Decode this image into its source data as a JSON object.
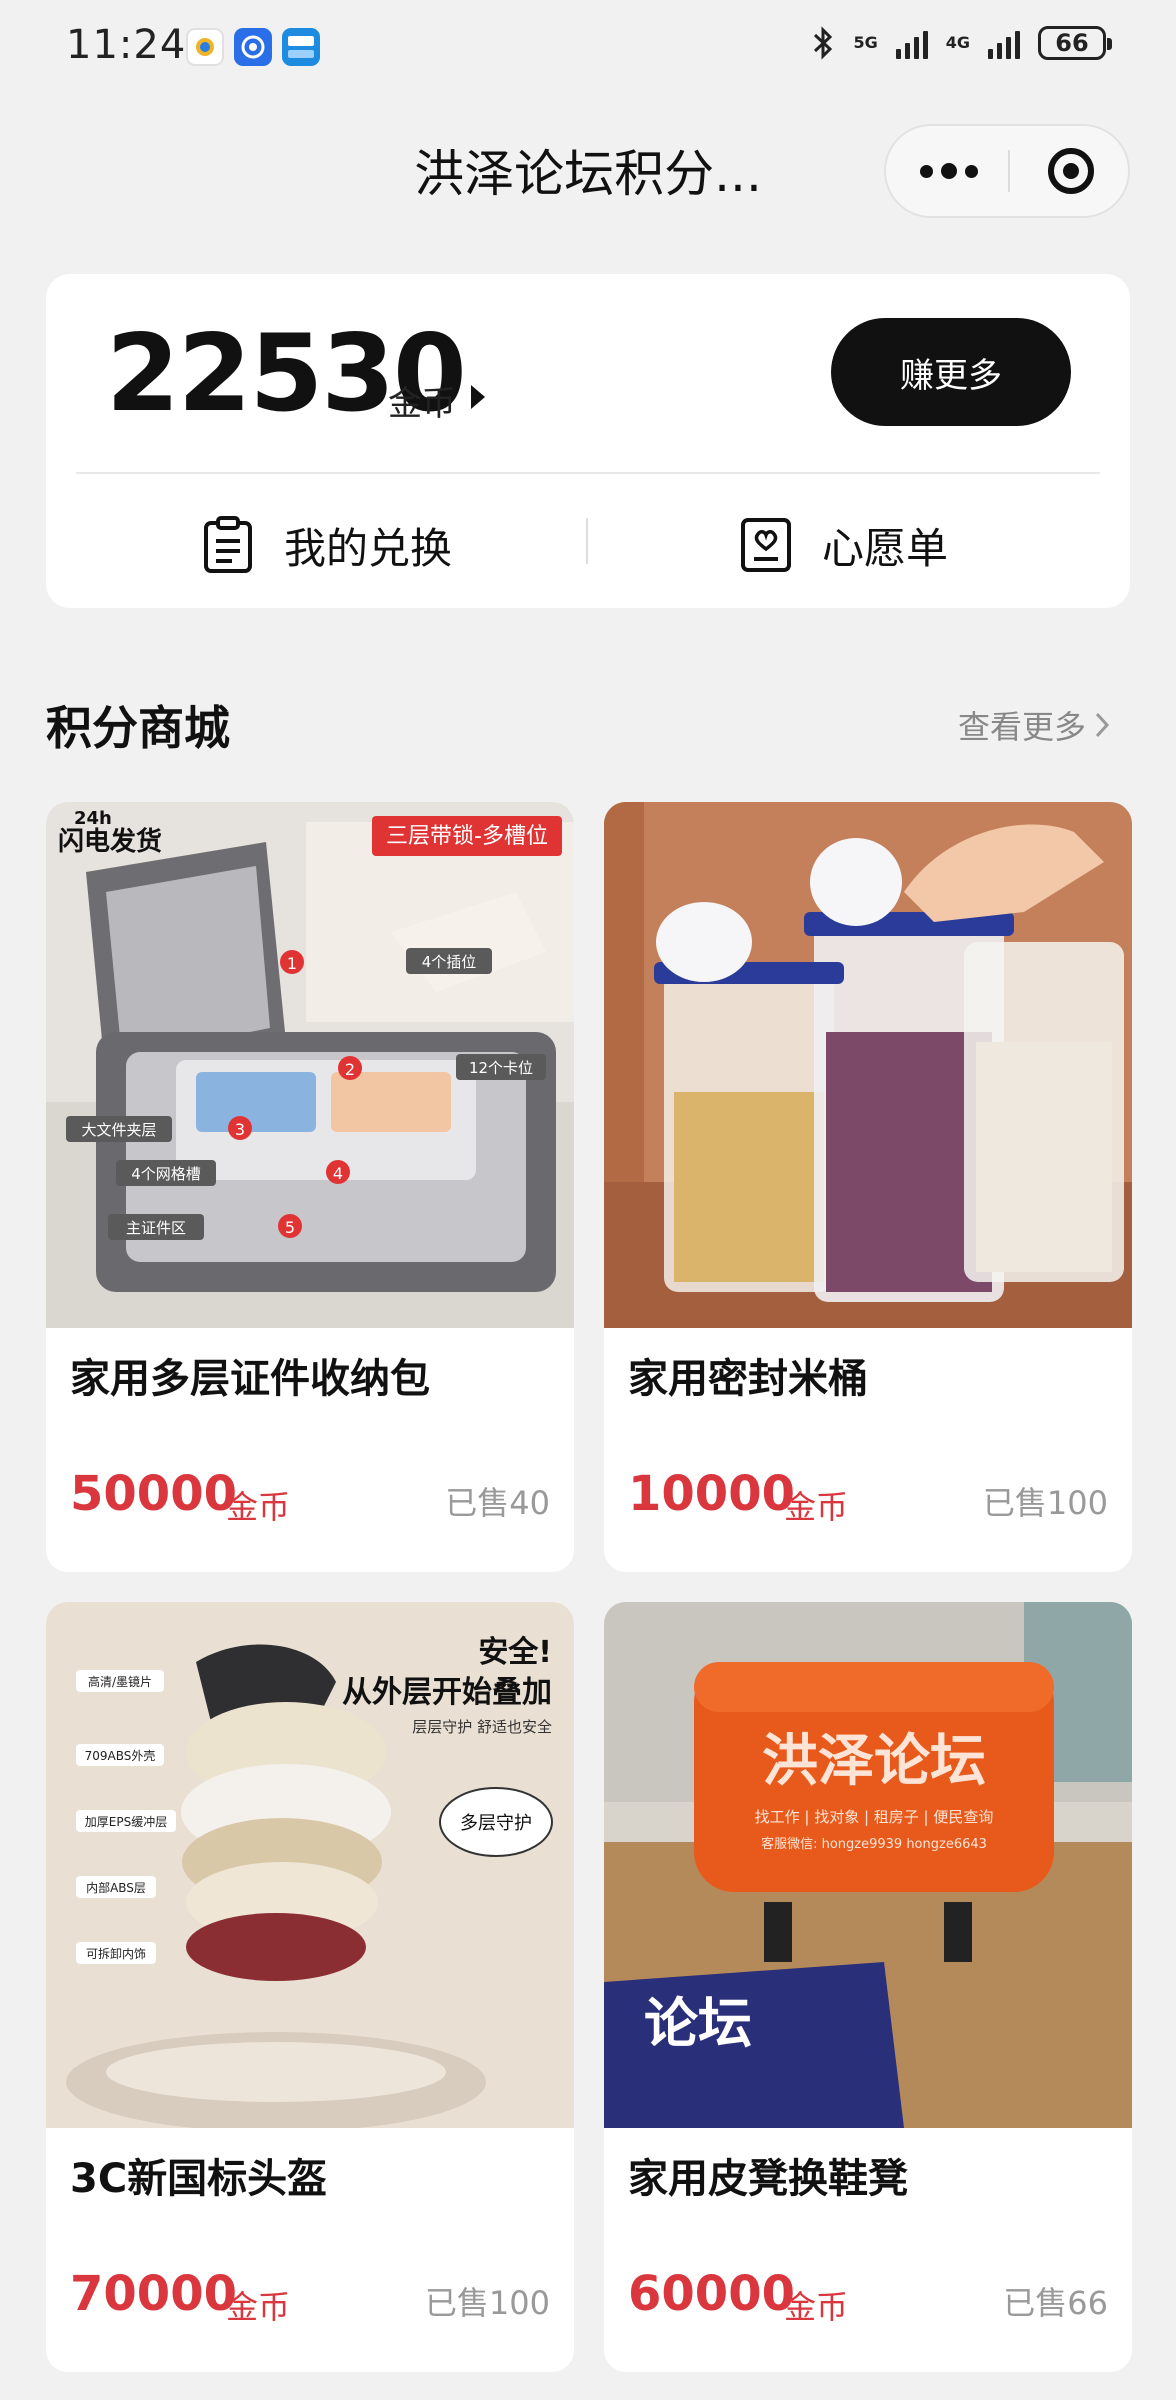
{
  "status_bar": {
    "time": "11:24",
    "network_label": "5G",
    "network_label_2": "4G",
    "battery": "66"
  },
  "nav": {
    "title": "洪泽论坛积分...",
    "more_icon": "more-dots-icon",
    "close_icon": "target-close-icon"
  },
  "points": {
    "value": "22530",
    "unit": "金币",
    "earn_more_label": "赚更多",
    "my_exchange_label": "我的兑换",
    "wishlist_label": "心愿单"
  },
  "mall": {
    "title": "积分商城",
    "see_more_label": "查看更多"
  },
  "products": [
    {
      "name": "家用多层证件收纳包",
      "price": "50000",
      "unit": "金币",
      "sold": "已售40",
      "image_text": {
        "banner": "三层带锁-多槽位",
        "badge_top": "24h",
        "badge_main": "闪电发货",
        "callout_1": "4个插位",
        "callout_2": "12个卡位",
        "callout_3": "大文件夹层",
        "callout_4": "4个网格槽",
        "callout_5": "主证件区",
        "num_1": "1",
        "num_2": "2",
        "num_3": "3",
        "num_4": "4",
        "num_5": "5"
      }
    },
    {
      "name": "家用密封米桶",
      "price": "10000",
      "unit": "金币",
      "sold": "已售100"
    },
    {
      "name": "3C新国标头盔",
      "price": "70000",
      "unit": "金币",
      "sold": "已售100",
      "image_text": {
        "headline_1": "安全!",
        "headline_2": "从外层开始叠加",
        "sub": "层层守护 舒适也安全",
        "bubble": "多层守护",
        "layer_1": "高清/墨镜片",
        "layer_2": "709ABS外壳",
        "layer_3": "加厚EPS缓冲层",
        "layer_4": "内部ABS层",
        "layer_5": "可拆卸内饰"
      }
    },
    {
      "name": "家用皮凳换鞋凳",
      "price": "60000",
      "unit": "金币",
      "sold": "已售66",
      "image_text": {
        "stool_title": "洪泽论坛",
        "stool_sub": "找工作 | 找对象 | 租房子 | 便民查询",
        "stool_contact": "客服微信: hongze9939 hongze6643",
        "poster_text": "论坛"
      }
    }
  ]
}
